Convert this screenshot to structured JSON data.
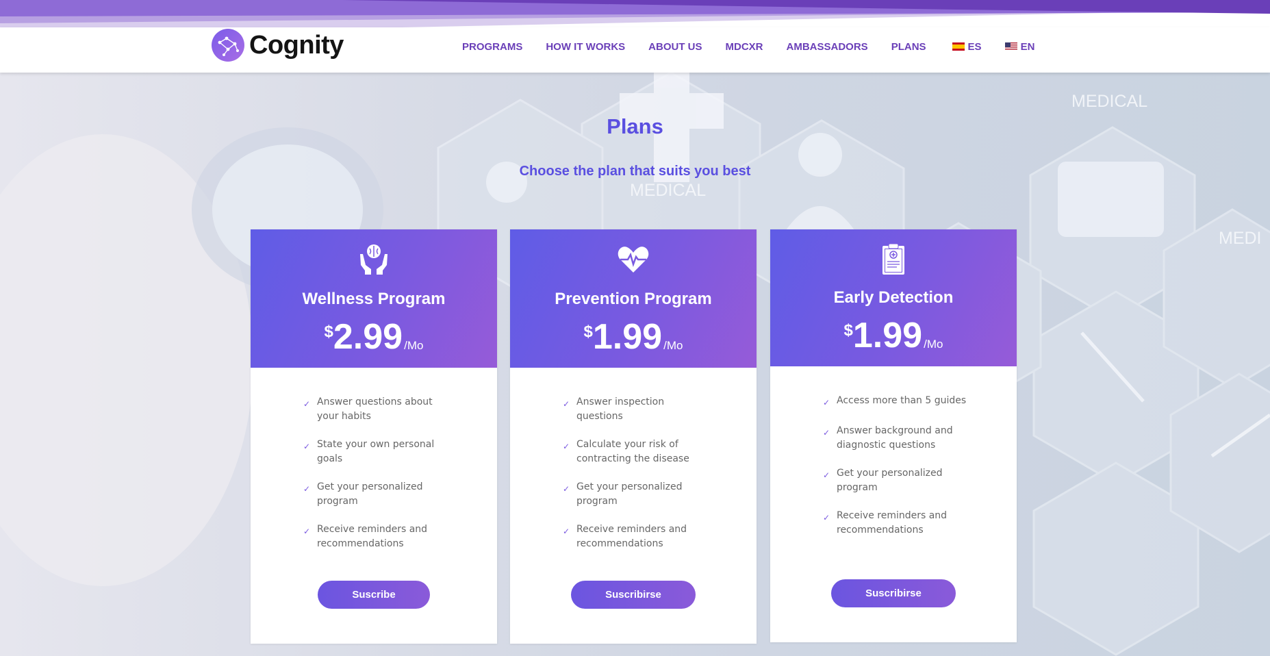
{
  "brand": {
    "name": "Cognity",
    "logo_icon": "constellation-icon"
  },
  "nav": {
    "items": [
      {
        "label": "PROGRAMS"
      },
      {
        "label": "HOW IT WORKS"
      },
      {
        "label": "ABOUT US"
      },
      {
        "label": "MDCXR"
      },
      {
        "label": "AMBASSADORS"
      },
      {
        "label": "PLANS"
      }
    ],
    "languages": [
      {
        "label": "ES",
        "flag": "spain-flag-icon"
      },
      {
        "label": "EN",
        "flag": "usa-flag-icon"
      }
    ]
  },
  "hero": {
    "title": "Plans",
    "subtitle": "Choose the plan that suits you best",
    "background_words": [
      "MEDICAL",
      "MEDICAL",
      "MEDI"
    ]
  },
  "plans": [
    {
      "icon": "hands-brain-icon",
      "name": "Wellness Program",
      "currency": "$",
      "price": "2.99",
      "period": "/Mo",
      "features": [
        "Answer questions about your habits",
        "State your own personal goals",
        "Get your personalized program",
        "Receive reminders and recommendations"
      ],
      "button": "Suscribe"
    },
    {
      "icon": "heart-pulse-icon",
      "name": "Prevention Program",
      "currency": "$",
      "price": "1.99",
      "period": "/Mo",
      "features": [
        "Answer inspection questions",
        "Calculate your risk of contracting the disease",
        "Get your personalized program",
        "Receive reminders and recommendations"
      ],
      "button": "Suscribirse"
    },
    {
      "icon": "clipboard-medical-icon",
      "name": "Early Detection",
      "currency": "$",
      "price": "1.99",
      "period": "/Mo",
      "features": [
        "Access more than 5 guides",
        "Answer background and diagnostic questions",
        "Get your personalized program",
        "Receive reminders and recommendations"
      ],
      "button": "Suscribirse"
    }
  ],
  "colors": {
    "accent": "#5a4fe0",
    "nav": "#6a3fb8",
    "card_gradient_start": "#5f5ce6",
    "card_gradient_end": "#965bd8"
  }
}
